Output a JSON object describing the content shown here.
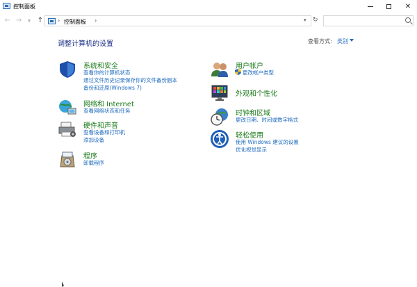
{
  "window": {
    "title": "控制面板"
  },
  "address": {
    "breadcrumb": "控制面板",
    "separator": "›",
    "search_placeholder": ""
  },
  "main": {
    "heading": "调整计算机的设置",
    "view_by_label": "查看方式:",
    "view_by_value": "类别"
  },
  "categories": {
    "system": {
      "title": "系统和安全",
      "links": [
        "查看你的计算机状态",
        "通过文件历史记录保存你的文件备份副本",
        "备份和还原(Windows 7)"
      ]
    },
    "network": {
      "title": "网络和 Internet",
      "links": [
        "查看网络状态和任务"
      ]
    },
    "hardware": {
      "title": "硬件和声音",
      "links": [
        "查看设备和打印机",
        "添加设备"
      ]
    },
    "programs": {
      "title": "程序",
      "links": [
        "卸载程序"
      ]
    },
    "accounts": {
      "title": "用户帐户",
      "links": [
        "更改帐户类型"
      ]
    },
    "appearance": {
      "title": "外观和个性化",
      "links": []
    },
    "clock": {
      "title": "时钟和区域",
      "links": [
        "更改日期、时间或数字格式"
      ]
    },
    "ease": {
      "title": "轻松使用",
      "links": [
        "使用 Windows 建议的设置",
        "优化视觉显示"
      ]
    }
  },
  "colors": {
    "category_title": "#1b7a1b",
    "link": "#1e6bbf",
    "heading": "#1e3287"
  }
}
